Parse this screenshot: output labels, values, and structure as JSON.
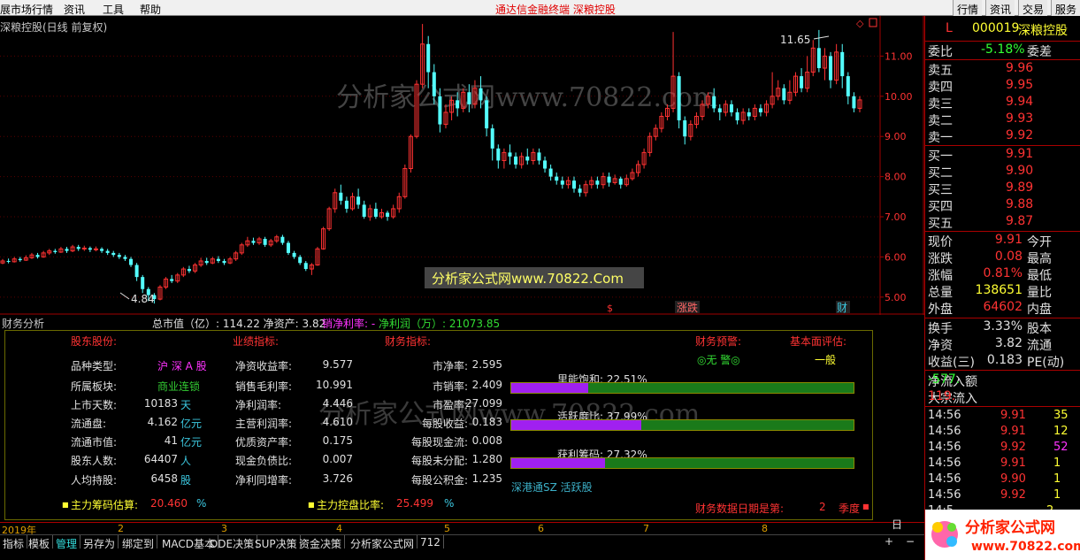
{
  "menu": {
    "items": [
      "展市场行情",
      "资讯",
      "工具",
      "帮助"
    ],
    "center_title": "通达信金融终端   深粮控股",
    "right_buttons": [
      "行情",
      "资讯",
      "交易",
      "服务"
    ]
  },
  "chart": {
    "title": "深粮控股(日线 前复权)",
    "price_ticks": [
      "11.00",
      "10.00",
      "9.00",
      "8.00",
      "7.00",
      "6.00",
      "5.00"
    ],
    "max_label": "11.65",
    "min_label": "4.84",
    "watermark": "分析家公式网www.70822.com",
    "watermark_box": "分析家公式网www.70822.Com",
    "markers": [
      "$",
      "涨跌",
      "财"
    ],
    "colors": {
      "up": "#ff3232",
      "down": "#54ffff",
      "axis": "#a00000",
      "ma": "#ffffff"
    }
  },
  "chart_data": {
    "type": "candlestick",
    "ylim": [
      4.6,
      12.0
    ],
    "candles": [
      [
        5.85,
        5.9,
        5.95,
        5.82
      ],
      [
        5.9,
        5.88,
        5.96,
        5.84
      ],
      [
        5.88,
        5.95,
        6.0,
        5.86
      ],
      [
        5.95,
        5.92,
        6.0,
        5.88
      ],
      [
        5.92,
        5.98,
        6.04,
        5.9
      ],
      [
        5.98,
        6.05,
        6.1,
        5.95
      ],
      [
        6.05,
        6.0,
        6.1,
        5.96
      ],
      [
        6.0,
        6.1,
        6.15,
        5.98
      ],
      [
        6.1,
        6.15,
        6.2,
        6.05
      ],
      [
        6.15,
        6.12,
        6.2,
        6.08
      ],
      [
        6.12,
        6.2,
        6.25,
        6.1
      ],
      [
        6.2,
        6.15,
        6.25,
        6.1
      ],
      [
        6.15,
        6.25,
        6.3,
        6.12
      ],
      [
        6.25,
        6.2,
        6.3,
        6.15
      ],
      [
        6.2,
        6.22,
        6.28,
        6.15
      ],
      [
        6.22,
        6.18,
        6.26,
        6.12
      ],
      [
        6.18,
        6.2,
        6.26,
        6.14
      ],
      [
        6.2,
        6.15,
        6.24,
        6.1
      ],
      [
        6.15,
        6.1,
        6.2,
        6.05
      ],
      [
        6.1,
        6.05,
        6.15,
        6.0
      ],
      [
        6.05,
        6.0,
        6.1,
        5.95
      ],
      [
        6.0,
        5.95,
        6.05,
        5.9
      ],
      [
        5.95,
        5.8,
        6.0,
        5.75
      ],
      [
        5.8,
        5.5,
        5.85,
        5.4
      ],
      [
        5.5,
        5.2,
        5.55,
        5.1
      ],
      [
        5.2,
        5.05,
        5.25,
        4.9
      ],
      [
        5.05,
        4.95,
        5.1,
        4.84
      ],
      [
        4.95,
        5.25,
        5.3,
        4.92
      ],
      [
        5.25,
        5.45,
        5.5,
        5.2
      ],
      [
        5.45,
        5.4,
        5.55,
        5.35
      ],
      [
        5.4,
        5.55,
        5.6,
        5.35
      ],
      [
        5.55,
        5.7,
        5.75,
        5.5
      ],
      [
        5.7,
        5.65,
        5.78,
        5.6
      ],
      [
        5.65,
        5.8,
        5.85,
        5.6
      ],
      [
        5.8,
        5.9,
        5.98,
        5.75
      ],
      [
        5.9,
        5.85,
        5.98,
        5.8
      ],
      [
        5.85,
        5.95,
        6.0,
        5.82
      ],
      [
        5.95,
        5.9,
        6.02,
        5.85
      ],
      [
        5.9,
        5.85,
        5.95,
        5.8
      ],
      [
        5.85,
        5.95,
        6.0,
        5.82
      ],
      [
        5.95,
        6.1,
        6.15,
        5.9
      ],
      [
        6.1,
        6.3,
        6.35,
        6.05
      ],
      [
        6.3,
        6.4,
        6.5,
        6.25
      ],
      [
        6.4,
        6.35,
        6.48,
        6.3
      ],
      [
        6.35,
        6.45,
        6.5,
        6.3
      ],
      [
        6.45,
        6.3,
        6.5,
        6.25
      ],
      [
        6.3,
        6.4,
        6.45,
        6.25
      ],
      [
        6.4,
        6.5,
        6.55,
        6.35
      ],
      [
        6.5,
        6.35,
        6.55,
        6.3
      ],
      [
        6.35,
        6.1,
        6.4,
        6.05
      ],
      [
        6.1,
        6.0,
        6.15,
        5.95
      ],
      [
        6.0,
        5.85,
        6.05,
        5.8
      ],
      [
        5.85,
        5.7,
        5.9,
        5.65
      ],
      [
        5.7,
        5.8,
        5.85,
        5.55
      ],
      [
        5.8,
        6.2,
        6.25,
        5.78
      ],
      [
        6.2,
        6.7,
        6.75,
        6.18
      ],
      [
        6.7,
        7.2,
        7.25,
        6.65
      ],
      [
        7.2,
        7.6,
        7.7,
        7.1
      ],
      [
        7.6,
        7.4,
        7.8,
        7.3
      ],
      [
        7.4,
        7.2,
        7.5,
        7.1
      ],
      [
        7.2,
        7.5,
        7.6,
        7.15
      ],
      [
        7.5,
        7.3,
        7.7,
        7.2
      ],
      [
        7.3,
        7.0,
        7.4,
        6.95
      ],
      [
        7.0,
        7.2,
        7.3,
        6.9
      ],
      [
        7.2,
        7.0,
        7.35,
        6.95
      ],
      [
        7.0,
        7.1,
        7.2,
        6.95
      ],
      [
        7.1,
        7.0,
        7.15,
        6.9
      ],
      [
        7.0,
        7.2,
        7.3,
        6.95
      ],
      [
        7.2,
        7.5,
        7.6,
        7.1
      ],
      [
        7.5,
        8.2,
        8.3,
        7.45
      ],
      [
        8.2,
        9.0,
        9.05,
        8.1
      ],
      [
        9.0,
        10.3,
        10.4,
        8.95
      ],
      [
        10.3,
        11.3,
        11.8,
        10.2
      ],
      [
        11.3,
        10.6,
        11.5,
        10.2
      ],
      [
        10.6,
        10.0,
        10.8,
        9.8
      ],
      [
        10.0,
        9.3,
        10.2,
        9.1
      ],
      [
        9.3,
        9.6,
        9.8,
        9.2
      ],
      [
        9.6,
        9.9,
        10.0,
        9.4
      ],
      [
        9.9,
        9.7,
        10.1,
        9.5
      ],
      [
        9.7,
        10.1,
        10.2,
        9.6
      ],
      [
        10.1,
        9.8,
        10.3,
        9.6
      ],
      [
        9.8,
        10.2,
        10.4,
        9.7
      ],
      [
        10.2,
        9.9,
        10.5,
        9.7
      ],
      [
        9.9,
        9.2,
        10.0,
        9.0
      ],
      [
        9.2,
        8.7,
        9.3,
        8.4
      ],
      [
        8.7,
        8.4,
        8.8,
        8.2
      ],
      [
        8.4,
        8.6,
        8.7,
        8.2
      ],
      [
        8.6,
        8.5,
        8.8,
        8.3
      ],
      [
        8.5,
        8.3,
        8.6,
        8.2
      ],
      [
        8.3,
        8.5,
        8.6,
        8.2
      ],
      [
        8.5,
        8.4,
        8.7,
        8.3
      ],
      [
        8.4,
        8.6,
        8.7,
        8.3
      ],
      [
        8.6,
        8.4,
        8.7,
        8.3
      ],
      [
        8.4,
        8.2,
        8.5,
        8.1
      ],
      [
        8.2,
        8.0,
        8.3,
        7.9
      ],
      [
        8.0,
        7.9,
        8.1,
        7.8
      ],
      [
        7.9,
        7.8,
        8.0,
        7.7
      ],
      [
        7.8,
        7.9,
        8.0,
        7.7
      ],
      [
        7.9,
        7.7,
        8.0,
        7.6
      ],
      [
        7.7,
        7.6,
        7.8,
        7.5
      ],
      [
        7.6,
        7.8,
        7.9,
        7.5
      ],
      [
        7.8,
        7.9,
        8.0,
        7.7
      ],
      [
        7.9,
        7.8,
        8.0,
        7.7
      ],
      [
        7.8,
        8.0,
        8.1,
        7.7
      ],
      [
        8.0,
        7.85,
        8.1,
        7.75
      ],
      [
        7.85,
        7.95,
        8.05,
        7.8
      ],
      [
        7.95,
        7.8,
        8.0,
        7.7
      ],
      [
        7.8,
        7.95,
        8.05,
        7.75
      ],
      [
        7.95,
        8.1,
        8.2,
        7.9
      ],
      [
        8.1,
        8.3,
        8.4,
        8.0
      ],
      [
        8.3,
        8.6,
        8.7,
        8.2
      ],
      [
        8.6,
        9.0,
        9.1,
        8.5
      ],
      [
        9.0,
        9.2,
        9.3,
        8.9
      ],
      [
        9.2,
        9.5,
        9.6,
        9.1
      ],
      [
        9.5,
        9.7,
        9.8,
        9.4
      ],
      [
        9.7,
        10.5,
        11.6,
        9.6
      ],
      [
        10.5,
        9.4,
        10.6,
        9.2
      ],
      [
        9.4,
        9.0,
        9.5,
        8.8
      ],
      [
        9.0,
        9.3,
        9.4,
        8.9
      ],
      [
        9.3,
        9.5,
        9.6,
        9.2
      ],
      [
        9.5,
        9.8,
        9.9,
        9.4
      ],
      [
        9.8,
        10.0,
        10.1,
        9.7
      ],
      [
        10.0,
        9.7,
        10.2,
        9.6
      ],
      [
        9.7,
        9.6,
        9.8,
        9.4
      ],
      [
        9.6,
        9.8,
        9.9,
        9.5
      ],
      [
        9.8,
        9.6,
        9.9,
        9.5
      ],
      [
        9.6,
        9.4,
        9.7,
        9.3
      ],
      [
        9.4,
        9.6,
        9.7,
        9.3
      ],
      [
        9.6,
        9.5,
        9.7,
        9.4
      ],
      [
        9.5,
        9.7,
        9.8,
        9.4
      ],
      [
        9.7,
        9.6,
        9.8,
        9.5
      ],
      [
        9.6,
        9.8,
        9.9,
        9.5
      ],
      [
        9.8,
        10.0,
        10.6,
        9.7
      ],
      [
        10.0,
        10.2,
        10.4,
        9.9
      ],
      [
        10.2,
        9.9,
        10.3,
        9.8
      ],
      [
        9.9,
        10.1,
        10.4,
        9.8
      ],
      [
        10.1,
        10.5,
        10.6,
        10.0
      ],
      [
        10.5,
        10.2,
        10.7,
        10.1
      ],
      [
        10.2,
        10.6,
        11.0,
        10.1
      ],
      [
        10.6,
        11.2,
        11.4,
        10.5
      ],
      [
        11.2,
        10.7,
        11.65,
        10.6
      ],
      [
        10.7,
        11.0,
        11.2,
        10.4
      ],
      [
        11.0,
        10.4,
        11.1,
        10.2
      ],
      [
        10.4,
        11.1,
        11.3,
        10.3
      ],
      [
        11.1,
        10.5,
        11.3,
        10.2
      ],
      [
        10.5,
        10.0,
        10.6,
        9.8
      ],
      [
        10.0,
        9.7,
        10.1,
        9.6
      ],
      [
        9.7,
        9.91,
        10.0,
        9.6
      ]
    ]
  },
  "finance": {
    "header_left": "财务分析",
    "header_stats": "总市值（亿）: 114.22  净资产: 3.82",
    "header_margin": "销净利率: -",
    "header_profit": "净利润（万）: 21073.85",
    "section_titles": [
      "股东股份:",
      "业绩指标:",
      "财务指标:",
      "财务预警:",
      "基本面评估:"
    ],
    "warning": "◎无 警◎",
    "evaluation": "一般",
    "col1": [
      {
        "label": "品种类型:",
        "value": "沪 深 A 股",
        "unit": ""
      },
      {
        "label": "所属板块:",
        "value": "商业连锁",
        "unit": ""
      },
      {
        "label": "上市天数:",
        "value": "10183",
        "unit": "天"
      },
      {
        "label": "流通盘:",
        "value": "4.162",
        "unit": "亿元"
      },
      {
        "label": "流通市值:",
        "value": "41",
        "unit": "亿元"
      },
      {
        "label": "股东人数:",
        "value": "64407",
        "unit": "人"
      },
      {
        "label": "人均持股:",
        "value": "6458",
        "unit": "股"
      }
    ],
    "col2": [
      {
        "label": "净资收益率:",
        "value": "9.577"
      },
      {
        "label": "销售毛利率:",
        "value": "10.991"
      },
      {
        "label": "净利润率:",
        "value": "4.446"
      },
      {
        "label": "主营利润率:",
        "value": "4.610"
      },
      {
        "label": "优质资产率:",
        "value": "0.175"
      },
      {
        "label": "现金负债比:",
        "value": "0.007"
      },
      {
        "label": "净利同增率:",
        "value": "3.726"
      }
    ],
    "col3": [
      {
        "label": "市净率:",
        "value": "2.595"
      },
      {
        "label": "市销率:",
        "value": "2.409"
      },
      {
        "label": "市盈率:",
        "value": "27.099"
      },
      {
        "label": "每股收益:",
        "value": "0.183"
      },
      {
        "label": "每股现金流:",
        "value": "0.008"
      },
      {
        "label": "每股未分配:",
        "value": "1.280"
      },
      {
        "label": "每股公积金:",
        "value": "1.235"
      }
    ],
    "bars": [
      {
        "label": "里能饱和:",
        "value": "22.51%",
        "fraction": 0.2251
      },
      {
        "label": "活跃度比:",
        "value": "37.99%",
        "fraction": 0.3799
      },
      {
        "label": "获利筹码:",
        "value": "27.32%",
        "fraction": 0.2732
      }
    ],
    "tag": "深港通SZ 活跃股",
    "chip_estimate_label": "主力筹码估算:",
    "chip_estimate_value": "20.460",
    "control_label": "主力控盘比率:",
    "control_value": "25.499",
    "percent": "%",
    "report_label": "财务数据日期是第:",
    "report_value": "2",
    "report_unit": "季度"
  },
  "date_axis": [
    "2019年",
    "2",
    "3",
    "4",
    "5",
    "6",
    "7",
    "8"
  ],
  "tabs": [
    "指标",
    "模板",
    "管理",
    "另存为",
    "绑定到",
    "MACD基本",
    "DDE决策",
    "SUP决策",
    "资金决策",
    "分析家公式网",
    "712"
  ],
  "right_panel": {
    "code_marker": "L",
    "code": "000019",
    "name": "深粮控股",
    "webi_label": "委比",
    "webi_value": "-5.18%",
    "wecha_label": "委差",
    "asks": [
      {
        "label": "卖五",
        "price": "9.96"
      },
      {
        "label": "卖四",
        "price": "9.95"
      },
      {
        "label": "卖三",
        "price": "9.94"
      },
      {
        "label": "卖二",
        "price": "9.93"
      },
      {
        "label": "卖一",
        "price": "9.92"
      }
    ],
    "bids": [
      {
        "label": "买一",
        "price": "9.91"
      },
      {
        "label": "买二",
        "price": "9.90"
      },
      {
        "label": "买三",
        "price": "9.89"
      },
      {
        "label": "买四",
        "price": "9.88"
      },
      {
        "label": "买五",
        "price": "9.87"
      }
    ],
    "quote": [
      {
        "l1": "现价",
        "v": "9.91",
        "l2": "今开"
      },
      {
        "l1": "涨跌",
        "v": "0.08",
        "l2": "最高"
      },
      {
        "l1": "涨幅",
        "v": "0.81%",
        "l2": "最低"
      },
      {
        "l1": "总量",
        "v": "138651",
        "l2": "量比"
      },
      {
        "l1": "外盘",
        "v": "64602",
        "l2": "内盘"
      }
    ],
    "stats": [
      {
        "l1": "换手",
        "v": "3.33%",
        "l2": "股本"
      },
      {
        "l1": "净资",
        "v": "3.82",
        "l2": "流通"
      },
      {
        "l1": "收益(三)",
        "v": "0.183",
        "l2": "PE(动)"
      }
    ],
    "flow": [
      {
        "label": "净流入额",
        "value": "-577."
      },
      {
        "label": "大宗流入",
        "value": "119."
      }
    ],
    "ticks": [
      {
        "t": "14:56",
        "p": "9.91",
        "v": "35"
      },
      {
        "t": "14:56",
        "p": "9.91",
        "v": "12"
      },
      {
        "t": "14:56",
        "p": "9.92",
        "v": "52"
      },
      {
        "t": "14:56",
        "p": "9.91",
        "v": "1"
      },
      {
        "t": "14:56",
        "p": "9.90",
        "v": "1"
      },
      {
        "t": "14:56",
        "p": "9.92",
        "v": "1"
      }
    ],
    "logo_text": "分析家公式网",
    "logo_url": "www.70822.com"
  }
}
